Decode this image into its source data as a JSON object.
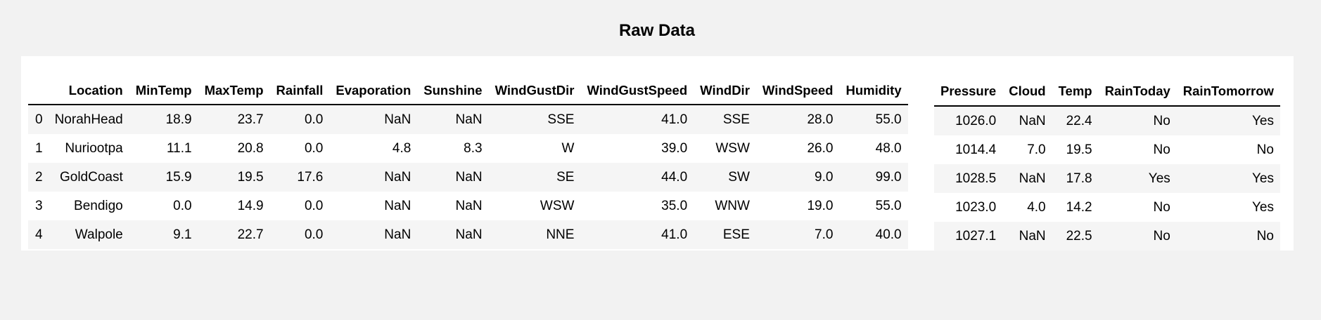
{
  "title": "Raw Data",
  "columns_left": [
    "Location",
    "MinTemp",
    "MaxTemp",
    "Rainfall",
    "Evaporation",
    "Sunshine",
    "WindGustDir",
    "WindGustSpeed",
    "WindDir",
    "WindSpeed",
    "Humidity"
  ],
  "columns_right": [
    "Pressure",
    "Cloud",
    "Temp",
    "RainToday",
    "RainTomorrow"
  ],
  "rows": [
    {
      "index": "0",
      "left": [
        "NorahHead",
        "18.9",
        "23.7",
        "0.0",
        "NaN",
        "NaN",
        "SSE",
        "41.0",
        "SSE",
        "28.0",
        "55.0"
      ],
      "right": [
        "1026.0",
        "NaN",
        "22.4",
        "No",
        "Yes"
      ]
    },
    {
      "index": "1",
      "left": [
        "Nuriootpa",
        "11.1",
        "20.8",
        "0.0",
        "4.8",
        "8.3",
        "W",
        "39.0",
        "WSW",
        "26.0",
        "48.0"
      ],
      "right": [
        "1014.4",
        "7.0",
        "19.5",
        "No",
        "No"
      ]
    },
    {
      "index": "2",
      "left": [
        "GoldCoast",
        "15.9",
        "19.5",
        "17.6",
        "NaN",
        "NaN",
        "SE",
        "44.0",
        "SW",
        "9.0",
        "99.0"
      ],
      "right": [
        "1028.5",
        "NaN",
        "17.8",
        "Yes",
        "Yes"
      ]
    },
    {
      "index": "3",
      "left": [
        "Bendigo",
        "0.0",
        "14.9",
        "0.0",
        "NaN",
        "NaN",
        "WSW",
        "35.0",
        "WNW",
        "19.0",
        "55.0"
      ],
      "right": [
        "1023.0",
        "4.0",
        "14.2",
        "No",
        "Yes"
      ]
    },
    {
      "index": "4",
      "left": [
        "Walpole",
        "9.1",
        "22.7",
        "0.0",
        "NaN",
        "NaN",
        "NNE",
        "41.0",
        "ESE",
        "7.0",
        "40.0"
      ],
      "right": [
        "1027.1",
        "NaN",
        "22.5",
        "No",
        "No"
      ]
    }
  ]
}
